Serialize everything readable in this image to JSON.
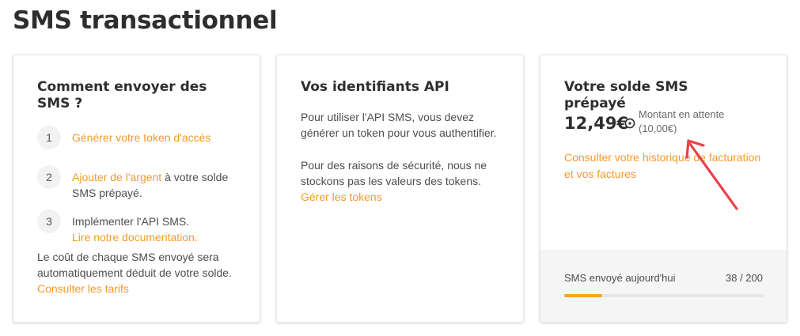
{
  "page": {
    "title": "SMS transactionnel"
  },
  "card_how": {
    "title": "Comment envoyer des SMS ?",
    "steps": [
      {
        "number": "1",
        "link": "Générer votre token d'accès",
        "text": ""
      },
      {
        "number": "2",
        "link": "Ajouter de l'argent",
        "text": " à votre solde SMS prépayé."
      },
      {
        "number": "3",
        "text": "Implémenter l'API SMS.",
        "link": "Lire notre documentation."
      }
    ],
    "cost_text": "Le coût de chaque SMS envoyé sera automatiquement déduit de votre solde. ",
    "cost_link": "Consulter les tarifs"
  },
  "card_api": {
    "title": "Vos identifiants API",
    "paragraph1": "Pour utiliser l'API SMS, vous devez générer un token pour vous authentifier.",
    "paragraph2": "Pour des raisons de sécurité, nous ne stockons pas les valeurs des tokens. ",
    "paragraph2_link": "Gérer les tokens"
  },
  "card_balance": {
    "title": "Votre solde SMS prépayé",
    "amount": "12,49€",
    "clock_icon": "clock-icon",
    "pending_label": "Montant en attente",
    "pending_amount": "(10,00€)",
    "history_link": "Consulter votre historique de facturation et vos factures",
    "sent_label": "SMS envoyé aujourd'hui",
    "sent_count": "38 / 200",
    "sent_progress": 0.19
  },
  "colors": {
    "link": "#f49a2a",
    "progress": "#f5a623",
    "annotation_arrow": "#e8414a"
  }
}
